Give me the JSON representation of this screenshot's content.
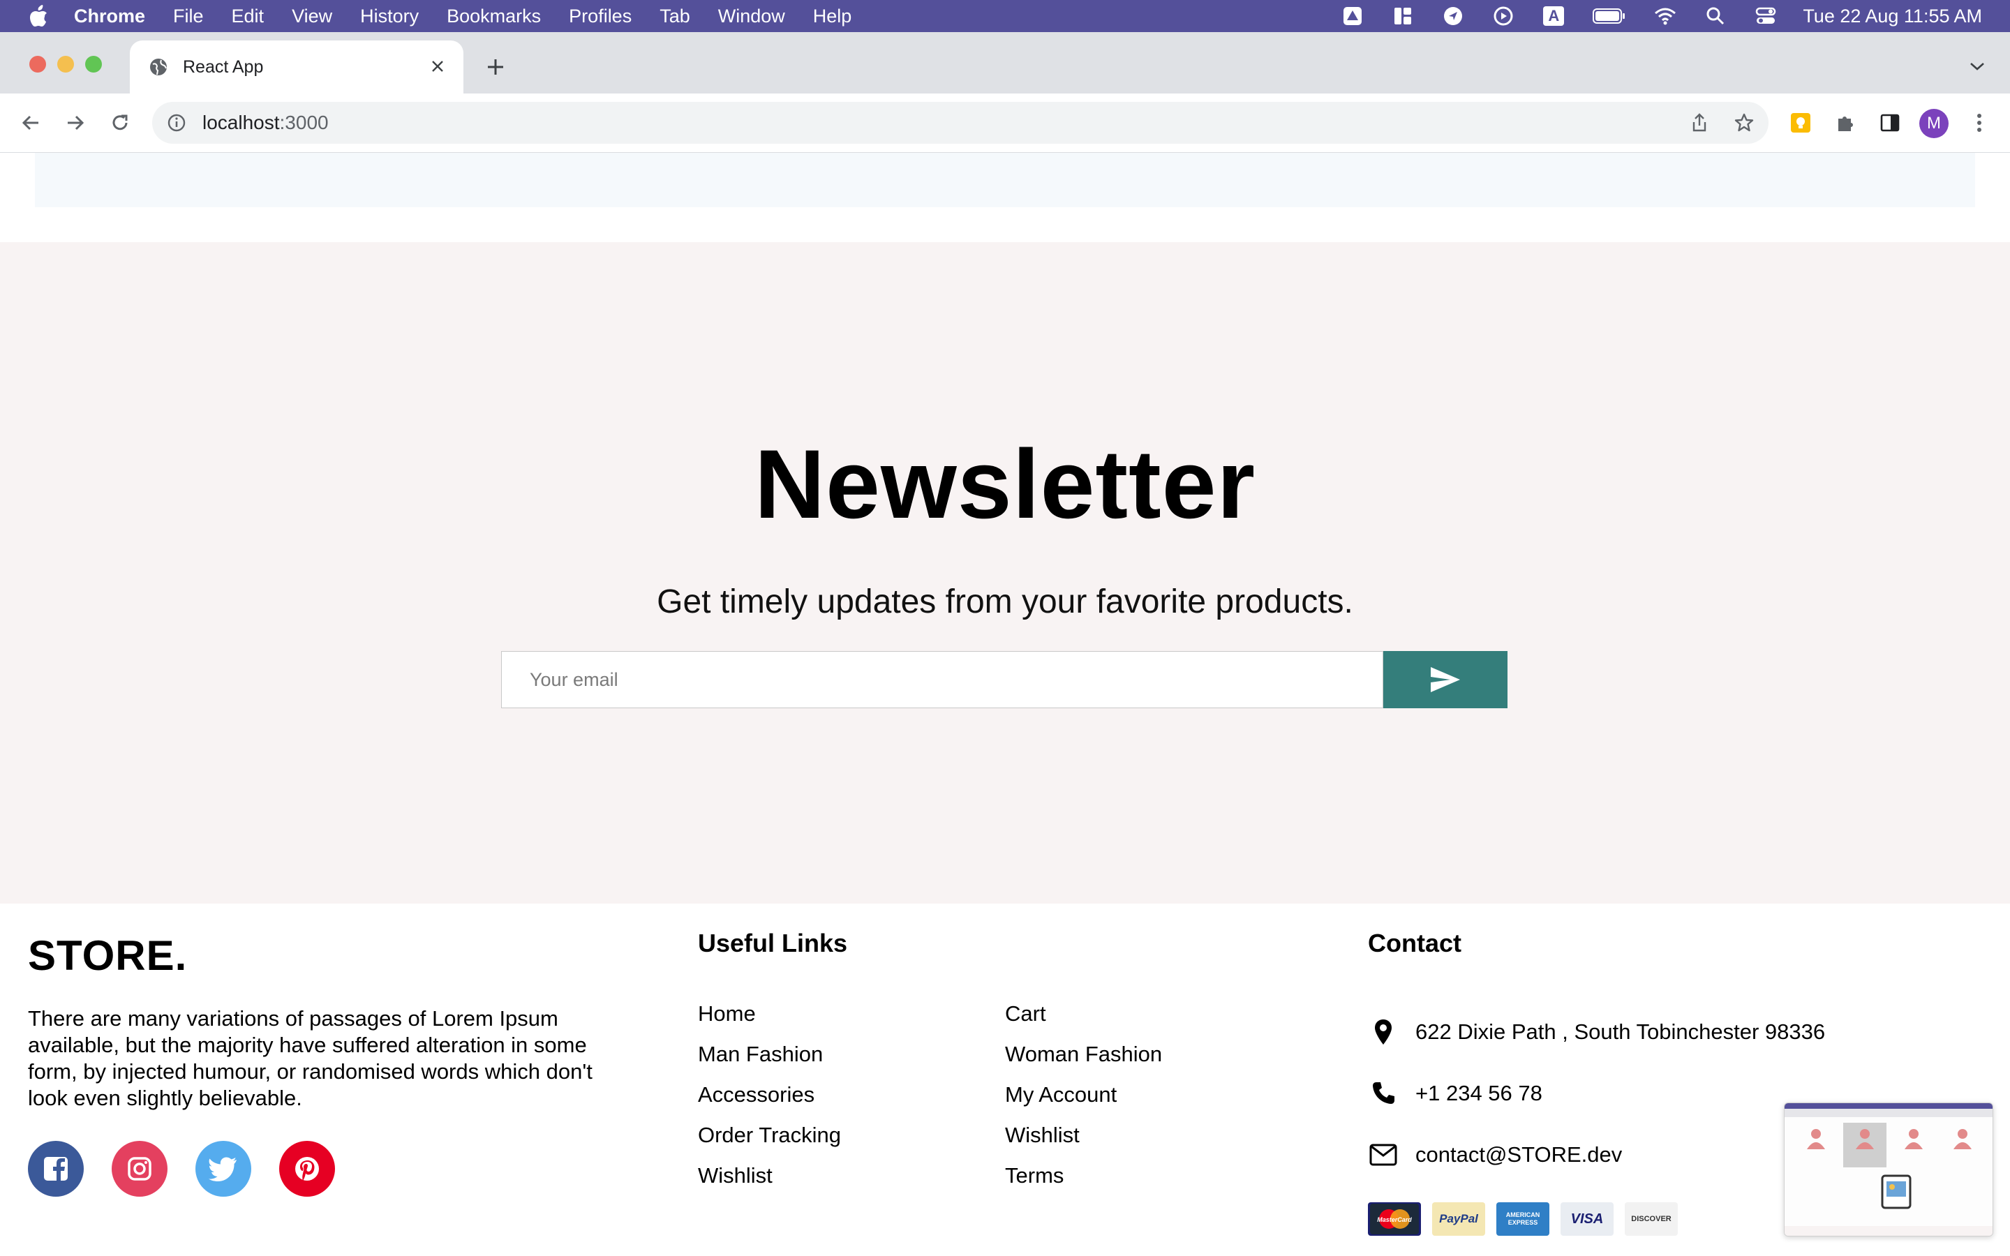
{
  "menubar": {
    "app_name": "Chrome",
    "menus": [
      "File",
      "Edit",
      "View",
      "History",
      "Bookmarks",
      "Profiles",
      "Tab",
      "Window",
      "Help"
    ],
    "clock": "Tue 22 Aug  11:55 AM",
    "input_source": "A"
  },
  "browser": {
    "tab_title": "React App",
    "url_host": "localhost",
    "url_port": ":3000",
    "profile_initial": "M"
  },
  "newsletter": {
    "title": "Newsletter",
    "subtitle": "Get timely updates from your favorite products.",
    "email_placeholder": "Your email"
  },
  "footer": {
    "brand": "STORE.",
    "description": "There are many variations of passages of Lorem Ipsum available, but the majority have suffered alteration in some form, by injected humour, or randomised words which don't look even slightly believable.",
    "useful_links_title": "Useful Links",
    "links_col1": [
      "Home",
      "Man Fashion",
      "Accessories",
      "Order Tracking",
      "Wishlist"
    ],
    "links_col2": [
      "Cart",
      "Woman Fashion",
      "My Account",
      "Wishlist",
      "Terms"
    ],
    "contact_title": "Contact",
    "address": "622 Dixie Path , South Tobinchester 98336",
    "phone": "+1 234 56 78",
    "email": "contact@STORE.dev",
    "payments": [
      "MasterCard",
      "PayPal",
      "AMERICAN EXPRESS",
      "VISA",
      "DISCOVER"
    ],
    "social_colors": {
      "facebook": "#3b5999",
      "instagram": "#e4405f",
      "twitter": "#55acee",
      "pinterest": "#e60023"
    }
  },
  "colors": {
    "menubar": "#54509a",
    "send_button": "#347e7b",
    "newsletter_bg": "#f8f3f3"
  }
}
